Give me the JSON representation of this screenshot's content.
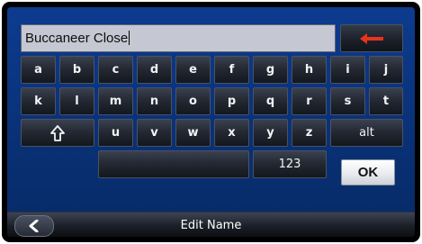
{
  "input": {
    "value": "Buccaneer Close"
  },
  "backspace": {
    "icon": "backspace-arrow-icon",
    "color": "#e8341c"
  },
  "keys": {
    "row1": [
      "a",
      "b",
      "c",
      "d",
      "e",
      "f",
      "g",
      "h",
      "i",
      "j"
    ],
    "row2": [
      "k",
      "l",
      "m",
      "n",
      "o",
      "p",
      "q",
      "r",
      "s",
      "t"
    ],
    "row3": [
      "u",
      "v",
      "w",
      "x",
      "y",
      "z"
    ],
    "shift": {
      "icon": "shift-arrow-icon"
    },
    "alt": "alt",
    "mode": "123",
    "ok": "OK"
  },
  "footer": {
    "title": "Edit Name",
    "back_icon": "chevron-left-icon"
  },
  "colors": {
    "screen_background": "#0a3480",
    "key_face": "#232832",
    "ok_face": "#e9ebef"
  }
}
